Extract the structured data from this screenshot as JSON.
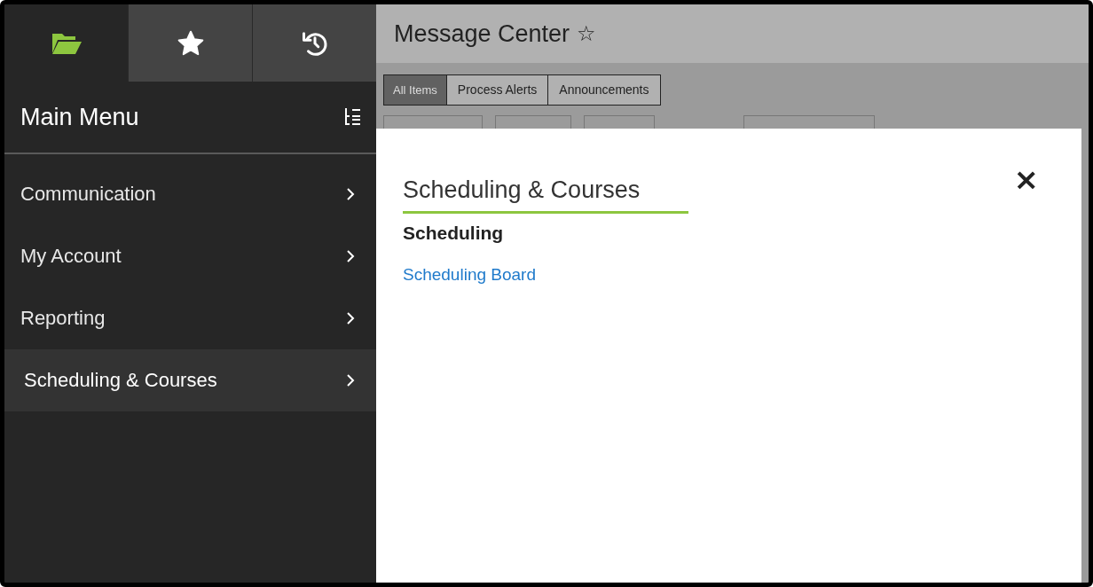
{
  "sidebar": {
    "tabs": [
      {
        "kind": "folder",
        "selected": true
      },
      {
        "kind": "star",
        "selected": false
      },
      {
        "kind": "history",
        "selected": false
      }
    ],
    "heading": "Main Menu",
    "items": [
      {
        "label": "Communication",
        "selected": false
      },
      {
        "label": "My Account",
        "selected": false
      },
      {
        "label": "Reporting",
        "selected": false
      },
      {
        "label": "Scheduling & Courses",
        "selected": true
      }
    ]
  },
  "page": {
    "title": "Message Center",
    "favorite_icon": "☆",
    "tabs": [
      {
        "label": "All Items",
        "selected": true
      },
      {
        "label": "Process Alerts",
        "selected": false
      },
      {
        "label": "Announcements",
        "selected": false
      }
    ]
  },
  "panel": {
    "title": "Scheduling & Courses",
    "close": "×",
    "sections": [
      {
        "heading": "Scheduling",
        "links": [
          "Scheduling Board"
        ]
      }
    ]
  }
}
